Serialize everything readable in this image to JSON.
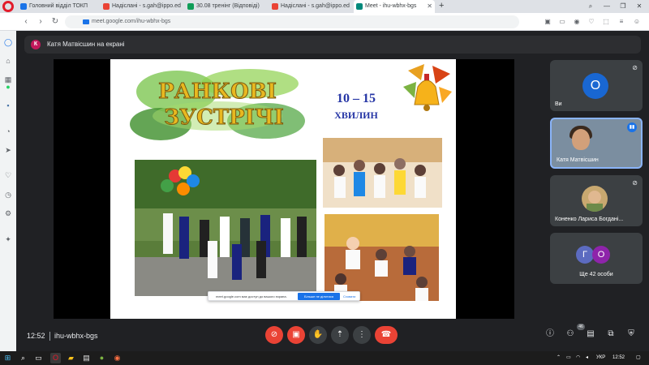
{
  "browser": {
    "tabs": [
      {
        "label": "Головний відділ ТОКП",
        "icon_color": "#1a73e8"
      },
      {
        "label": "Надіслані - s.gah@ippo.ed",
        "icon_color": "#ea4335"
      },
      {
        "label": "30.08 тренінг (Відповіді)",
        "icon_color": "#0f9d58"
      },
      {
        "label": "Надіслані - s.gah@ippo.ed",
        "icon_color": "#ea4335"
      },
      {
        "label": "Meet - ihu-wbhx-bgs",
        "icon_color": "#00897b"
      }
    ],
    "url": "meet.google.com/ihu-wbhx-bgs"
  },
  "meet": {
    "presenting_initial": "К",
    "presenting_text": "Катя Матвісшин на екрані",
    "slide": {
      "title_line1": "РАНКОВІ",
      "title_line2": "ЗУСТРІЧІ",
      "time_value": "10 – 15",
      "time_unit": "ХВИЛИН"
    },
    "share_notice": {
      "message": "meet.google.com має доступ до вашого екрана.",
      "stop_label": "Більше не ділитися",
      "hide_label": "Сховати"
    },
    "participants": [
      {
        "name": "Ви",
        "initial": "О",
        "muted": true
      },
      {
        "name": "Катя Матвісшин",
        "speaking": true
      },
      {
        "name": "Коненко Лариса Богдані...",
        "muted": true
      },
      {
        "more_label": "Ще 42 особи",
        "initials": [
          "Г",
          "О"
        ]
      }
    ],
    "bottom": {
      "time": "12:52",
      "meeting_code": "ihu-wbhx-bgs",
      "people_count": "46"
    }
  },
  "taskbar": {
    "language": "УКР",
    "time": "12:52"
  },
  "colors": {
    "meet_bg": "#202124",
    "tile_bg": "#3c4043",
    "hangup_red": "#ea4335",
    "accent_blue": "#1a73e8"
  }
}
